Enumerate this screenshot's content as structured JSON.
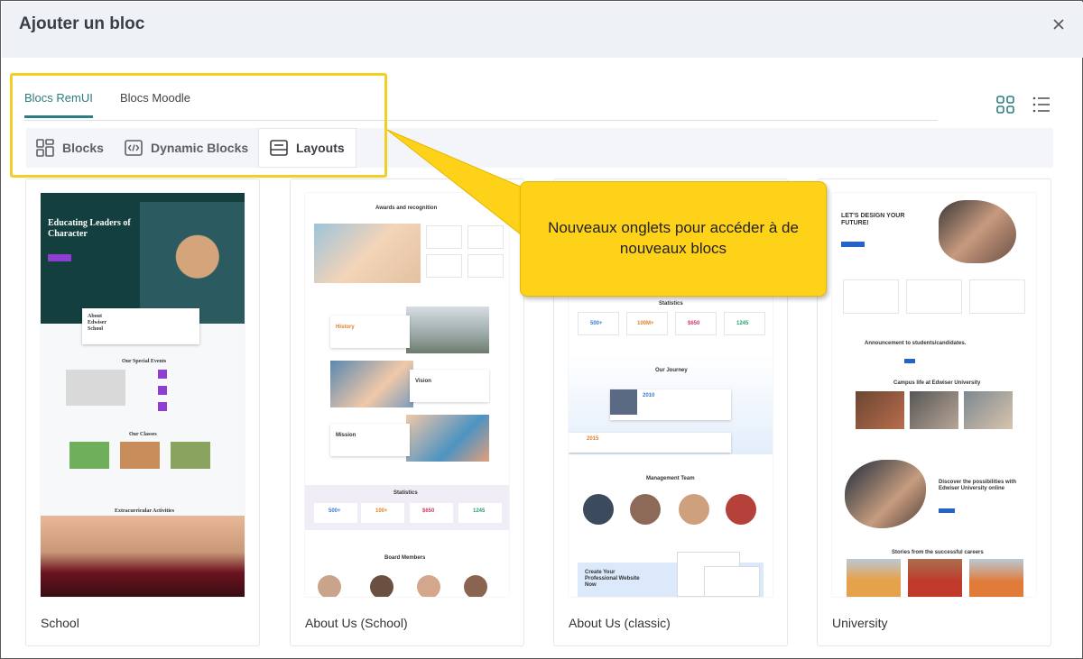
{
  "modal": {
    "title": "Ajouter un bloc",
    "close_icon": "close-icon"
  },
  "tabs": [
    {
      "label": "Blocs RemUI",
      "active": true
    },
    {
      "label": "Blocs Moodle",
      "active": false
    }
  ],
  "view_toggles": {
    "grid_icon": "grid-view-icon",
    "list_icon": "list-view-icon"
  },
  "subtabs": [
    {
      "label": "Blocks",
      "icon": "blocks-icon"
    },
    {
      "label": "Dynamic Blocks",
      "icon": "code-icon"
    },
    {
      "label": "Layouts",
      "icon": "layout-icon",
      "active": true
    }
  ],
  "cards": [
    {
      "title": "School",
      "thumb": {
        "hero_title": "Educating Leaders of Character",
        "about_title": "About Edwiser School",
        "special_title": "Our Special Events",
        "courses_title": "Our Classes",
        "activities_title": "Extracurricular Activities"
      }
    },
    {
      "title": "About Us (School)",
      "thumb": {
        "awards_title": "Awards and recognition",
        "history": "History",
        "vision": "Vision",
        "mission": "Mission",
        "stats_title": "Statistics",
        "stats": [
          "500+",
          "100+",
          "$650",
          "1245"
        ],
        "board_title": "Board Members"
      }
    },
    {
      "title": "About Us (classic)",
      "thumb": {
        "stats_title": "Statistics",
        "stats": [
          "500+",
          "100M+",
          "$650",
          "1245"
        ],
        "journey_title": "Our Journey",
        "years": [
          "2010",
          "2015"
        ],
        "team_title": "Management Team",
        "cta_title": "Create Your Professional Website Now"
      }
    },
    {
      "title": "University",
      "thumb": {
        "hero_title": "LET'S DESIGN YOUR FUTURE!",
        "announce_title": "Announcement to students/candidates.",
        "campus_title": "Campus life at Edwiser University",
        "discover_title": "Discover the possibilities with Edwiser University online",
        "stories_title": "Stories from the successful careers"
      }
    }
  ],
  "callout": {
    "text": "Nouveaux onglets pour accéder à de nouveaux blocs"
  },
  "colors": {
    "accent": "#2e7d80",
    "highlight": "#f2cf25",
    "callout": "#ffd21a"
  }
}
